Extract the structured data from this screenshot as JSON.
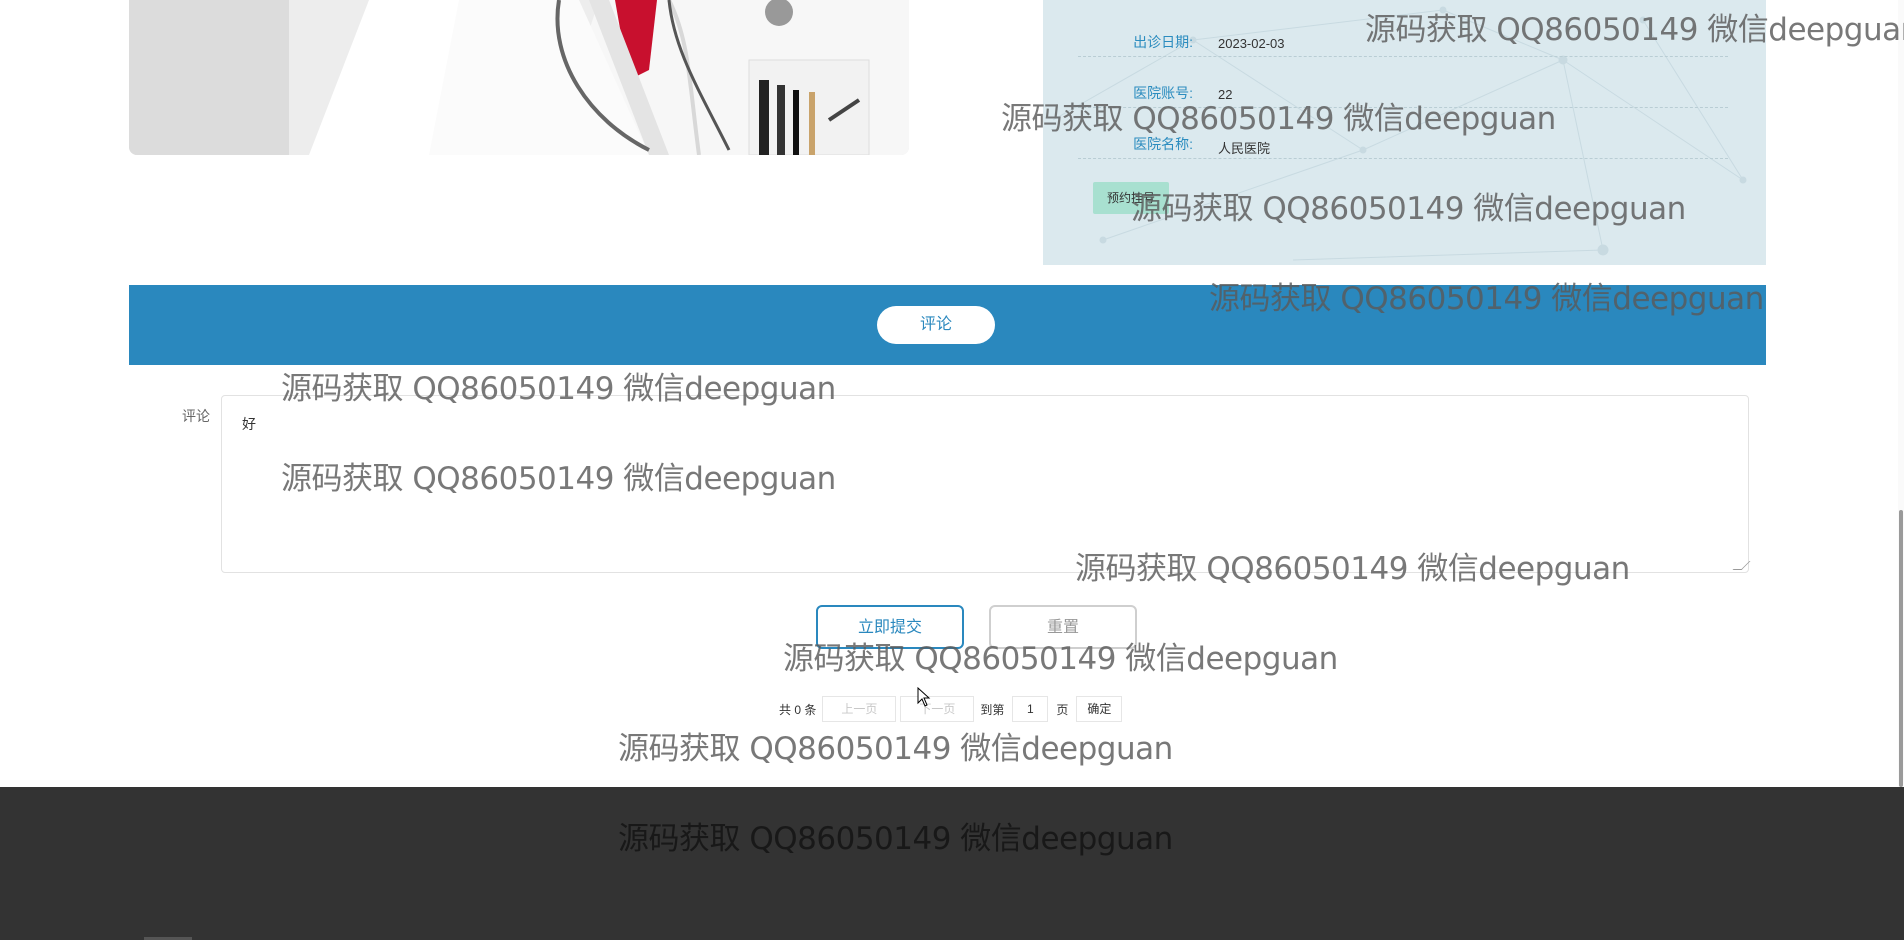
{
  "doctor_info": {
    "rows": [
      {
        "label": "出诊日期:",
        "value": "2023-02-03"
      },
      {
        "label": "医院账号:",
        "value": "22"
      },
      {
        "label": "医院名称:",
        "value": "人民医院"
      }
    ],
    "appointment_button": "预约挂号"
  },
  "comment_section": {
    "tab_label": "评论",
    "field_label": "评论",
    "comment_value": "好",
    "submit_label": "立即提交",
    "reset_label": "重置"
  },
  "pagination": {
    "total_text": "共 0 条",
    "prev_label": "上一页",
    "next_label": "下一页",
    "goto_label": "到第",
    "page_value": "1",
    "page_unit": "页",
    "confirm_label": "确定"
  },
  "watermark": {
    "text": "源码获取 QQ86050149 微信deepguan"
  },
  "colors": {
    "accent": "#2a88be",
    "panel_bg": "#dbe9ee",
    "appt_button": "#a8e0d0",
    "footer": "#333333"
  }
}
